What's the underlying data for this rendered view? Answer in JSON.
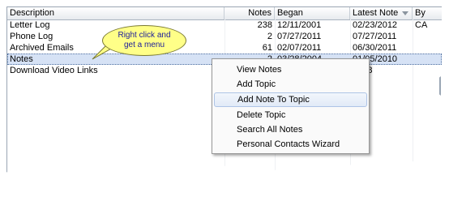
{
  "columns": [
    "Description",
    "Notes",
    "Began",
    "Latest Note",
    "By"
  ],
  "rows": [
    {
      "description": "Letter Log",
      "notes": "238",
      "began": "12/11/2001",
      "latest": "02/23/2012",
      "by": "CA"
    },
    {
      "description": "Phone Log",
      "notes": "2",
      "began": "07/27/2011",
      "latest": "07/27/2011",
      "by": ""
    },
    {
      "description": "Archived Emails",
      "notes": "61",
      "began": "02/07/2011",
      "latest": "06/30/2011",
      "by": ""
    },
    {
      "description": "Notes",
      "notes": "2",
      "began": "03/28/2004",
      "latest": "01/05/2010",
      "by": ""
    },
    {
      "description": "Download Video Links",
      "notes": "",
      "began": "",
      "latest": "2008",
      "by": ""
    }
  ],
  "callout": {
    "line1": "Right click and",
    "line2": "get a menu"
  },
  "context_menu": [
    "View Notes",
    "Add Topic",
    "Add Note To Topic",
    "Delete Topic",
    "Search All Notes",
    "Personal Contacts Wizard"
  ],
  "colors": {
    "selected_row": "#d6e2f5",
    "callout_fill": "#ffff88",
    "menu_highlight": "#e1eaf7"
  },
  "icons": {
    "sort": "sort-descending-icon"
  }
}
